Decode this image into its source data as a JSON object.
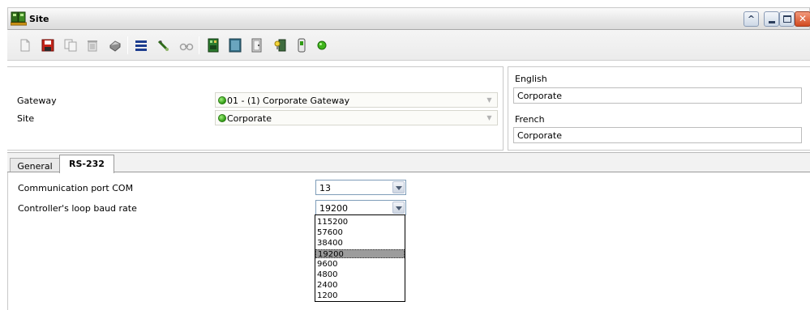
{
  "window": {
    "title": "Site"
  },
  "header": {
    "gateway_label": "Gateway",
    "gateway_value": "01 - (1)  Corporate Gateway",
    "site_label": "Site",
    "site_value": "Corporate",
    "english_label": "English",
    "english_value": "Corporate",
    "french_label": "French",
    "french_value": "Corporate"
  },
  "tabs": [
    {
      "label": "General",
      "active": false
    },
    {
      "label": "RS-232",
      "active": true
    }
  ],
  "form": {
    "com_label": "Communication port COM",
    "com_value": "13",
    "baud_label": "Controller's loop baud rate",
    "baud_value": "19200"
  },
  "baud_options": [
    "115200",
    "57600",
    "38400",
    "19200",
    "9600",
    "4800",
    "2400",
    "1200"
  ],
  "selected_baud": "19200",
  "toolbar_icons": [
    "new-icon",
    "save-icon",
    "copy-icon",
    "delete-icon",
    "print-icon",
    "list-icon",
    "edit-icon",
    "find-icon",
    "controller-icon",
    "gateway-icon",
    "door-icon",
    "reader-icon",
    "device-icon",
    "status-icon"
  ],
  "colors": {
    "status_green": "#2f9a13",
    "selected_row": "#9c9c9c",
    "close_button": "#d24a1f"
  }
}
